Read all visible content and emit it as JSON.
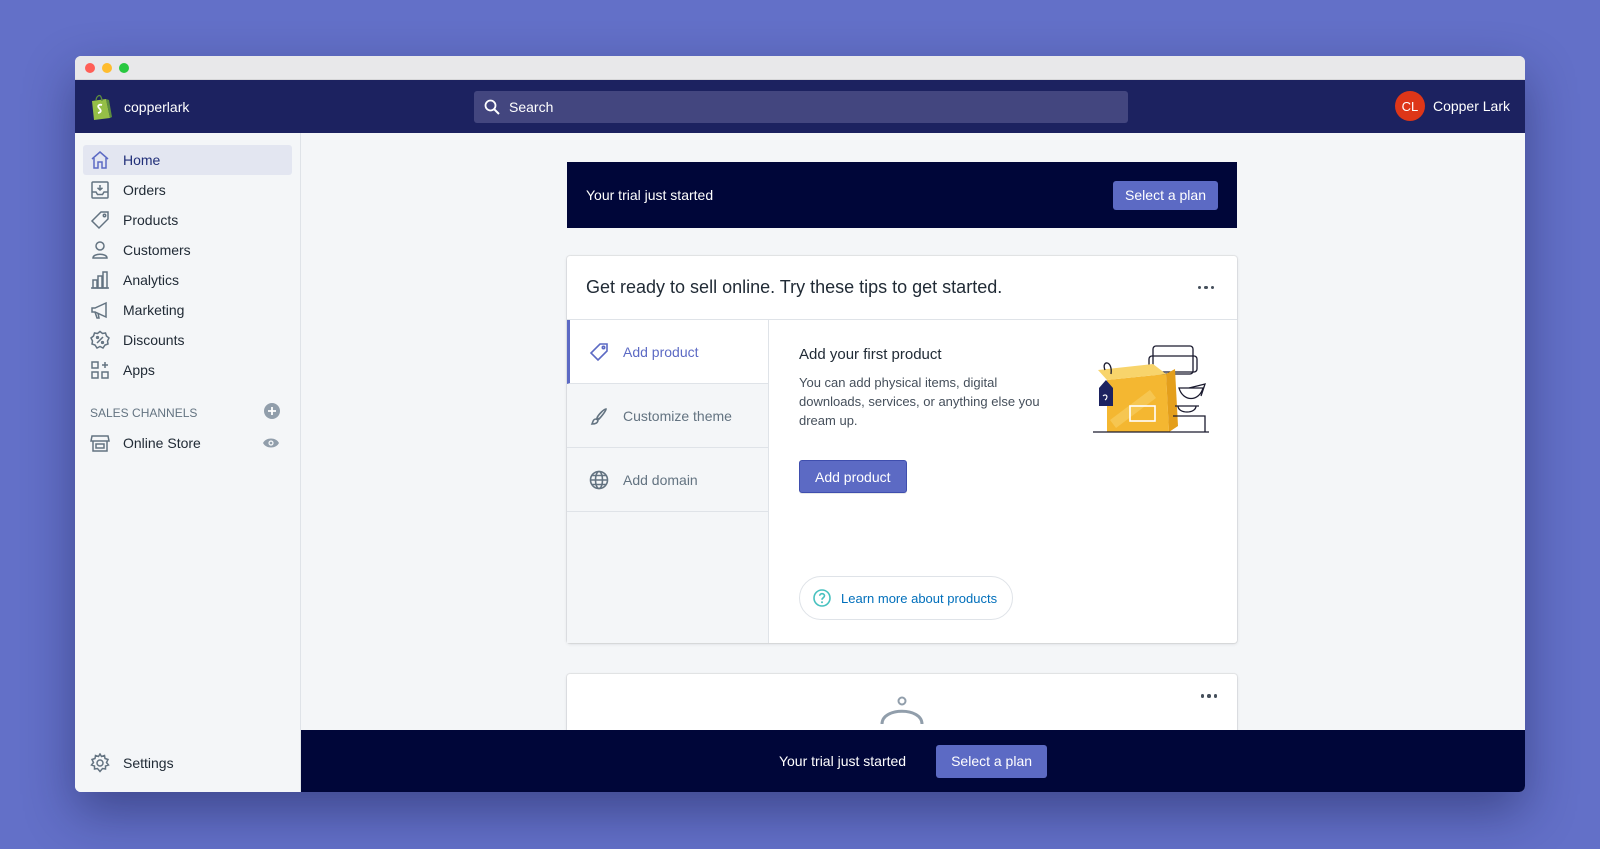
{
  "topbar": {
    "store_name": "copperlark",
    "search_placeholder": "Search",
    "user_initials": "CL",
    "user_name": "Copper Lark"
  },
  "sidebar": {
    "items": [
      {
        "label": "Home",
        "icon": "home-icon"
      },
      {
        "label": "Orders",
        "icon": "orders-icon"
      },
      {
        "label": "Products",
        "icon": "tag-icon"
      },
      {
        "label": "Customers",
        "icon": "person-icon"
      },
      {
        "label": "Analytics",
        "icon": "bar-chart-icon"
      },
      {
        "label": "Marketing",
        "icon": "megaphone-icon"
      },
      {
        "label": "Discounts",
        "icon": "discount-icon"
      },
      {
        "label": "Apps",
        "icon": "apps-icon"
      }
    ],
    "section_title": "SALES CHANNELS",
    "channels": [
      {
        "label": "Online Store",
        "icon": "store-icon"
      }
    ],
    "settings_label": "Settings"
  },
  "trial_banner": {
    "text": "Your trial just started",
    "button": "Select a plan"
  },
  "tips_card": {
    "title": "Get ready to sell online. Try these tips to get started.",
    "tabs": [
      {
        "label": "Add product",
        "icon": "tag-icon"
      },
      {
        "label": "Customize theme",
        "icon": "brush-icon"
      },
      {
        "label": "Add domain",
        "icon": "globe-icon"
      }
    ],
    "panel_title": "Add your first product",
    "panel_desc": "You can add physical items, digital downloads, services, or anything else you dream up.",
    "panel_button": "Add product",
    "learn_more": "Learn more about products"
  },
  "bottom_bar": {
    "text": "Your trial just started",
    "button": "Select a plan"
  },
  "colors": {
    "topbar": "#1c2260",
    "accent": "#5c6ac4",
    "banner": "#000639",
    "background": "#6370c8"
  }
}
